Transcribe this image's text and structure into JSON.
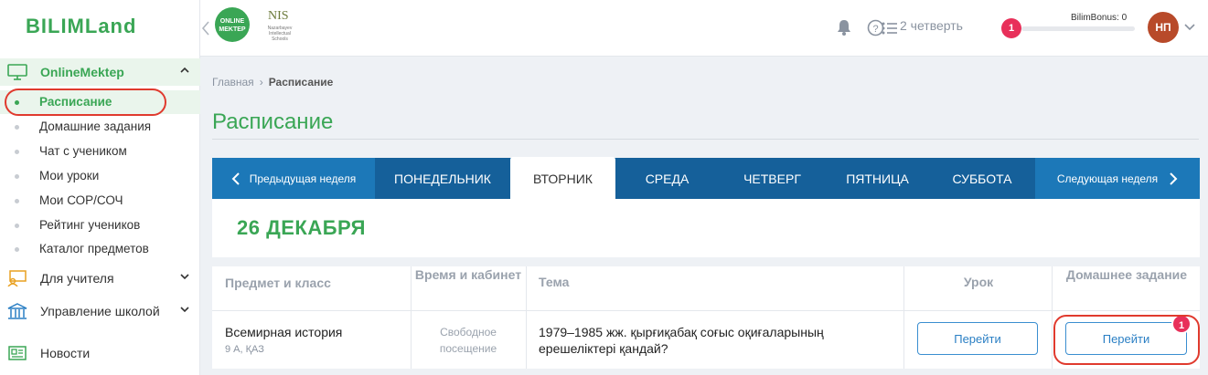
{
  "sidebar": {
    "logo": "BILIMLand",
    "online_mektep": "OnlineMektep",
    "items": [
      {
        "label": "Расписание"
      },
      {
        "label": "Домашние задания"
      },
      {
        "label": "Чат с учеником"
      },
      {
        "label": "Мои уроки"
      },
      {
        "label": "Мои СОР/СОЧ"
      },
      {
        "label": "Рейтинг учеников"
      },
      {
        "label": "Каталог предметов"
      }
    ],
    "teacher": "Для учителя",
    "school": "Управление школой",
    "news": "Новости"
  },
  "header": {
    "om_logo": "ONLINE MEKTEP",
    "nis_title": "NIS",
    "nis_sub": "Nazarbayev Intellectual Schools",
    "quarter": "2 четверть",
    "bonus_count": "1",
    "bonus_label": "BilimBonus: 0",
    "avatar": "НП"
  },
  "breadcrumb": {
    "home": "Главная",
    "current": "Расписание"
  },
  "page_title": "Расписание",
  "tabs": {
    "prev": "Предыдущая неделя",
    "next": "Следующая неделя",
    "days": [
      "ПОНЕДЕЛЬНИК",
      "ВТОРНИК",
      "СРЕДА",
      "ЧЕТВЕРГ",
      "ПЯТНИЦА",
      "СУББОТА"
    ],
    "selected": "ВТОРНИК"
  },
  "date": "26 ДЕКАБРЯ",
  "table": {
    "headers": [
      "Предмет и класс",
      "Время и кабинет",
      "Тема",
      "Урок",
      "Домашнее задание"
    ],
    "rows": [
      {
        "subject": "Всемирная история",
        "class": "9 А, ҚАЗ",
        "time": "Свободное посещение",
        "topic": "1979–1985 жж. қырғиқабақ соғыс оқиғаларының ерешеліктері қандай?",
        "lesson_button": "Перейти",
        "homework_button": "Перейти",
        "homework_badge": "1"
      }
    ]
  },
  "colors": {
    "green": "#3aa655",
    "blue": "#1c78b8",
    "dark_blue": "#15609a",
    "badge": "#e8305a",
    "annotation": "#e03a2e"
  }
}
